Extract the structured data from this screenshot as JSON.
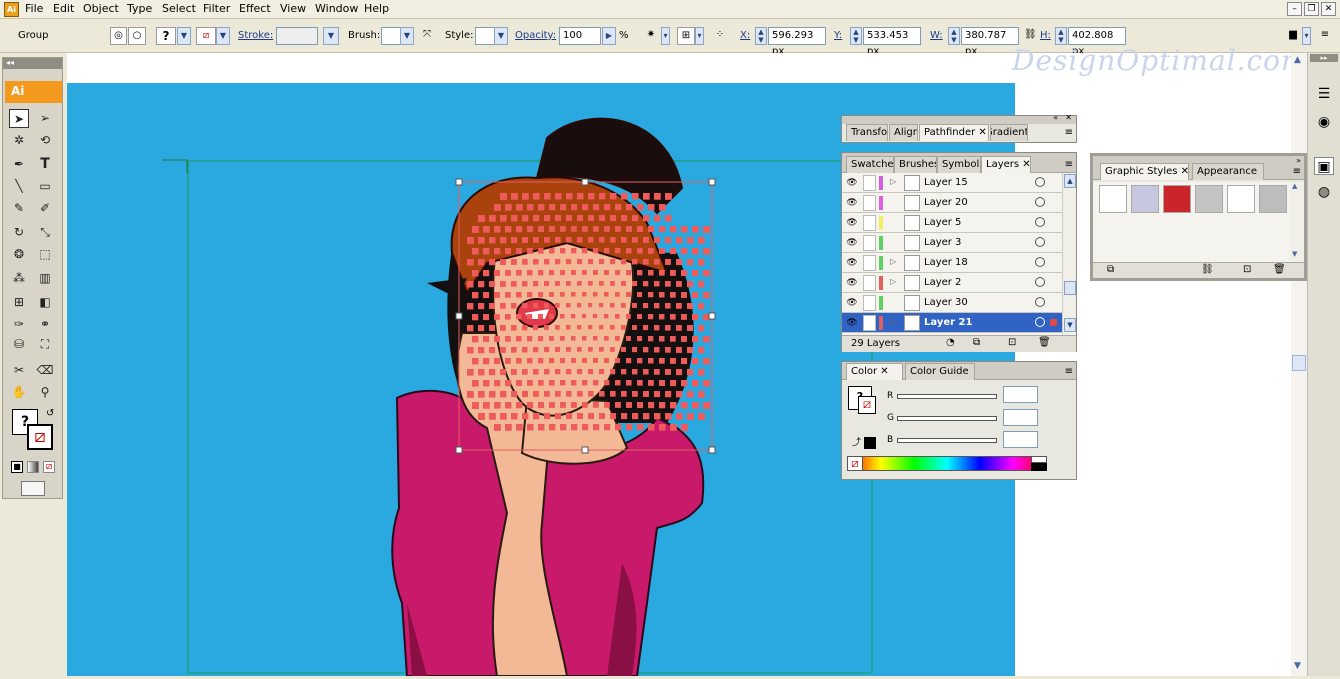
{
  "menubar": {
    "app_icon": "Ai",
    "items": [
      "File",
      "Edit",
      "Object",
      "Type",
      "Select",
      "Filter",
      "Effect",
      "View",
      "Window",
      "Help"
    ]
  },
  "controlbar": {
    "selection_type": "Group",
    "stroke_label": "Stroke:",
    "brush_label": "Brush:",
    "style_label": "Style:",
    "opacity_label": "Opacity:",
    "opacity_value": "100",
    "opacity_unit": "%",
    "x_label": "X:",
    "x_value": "596.293 px",
    "y_label": "Y:",
    "y_value": "533.453 px",
    "w_label": "W:",
    "w_value": "380.787 px",
    "h_label": "H:",
    "h_value": "402.808 px",
    "fill_glyph": "?"
  },
  "toolbox": {
    "logo": "Ai",
    "fill_glyph": "?"
  },
  "watermark": "DesignOptimal.com",
  "panel_top": {
    "tabs": [
      "Transform",
      "Align",
      "Pathfinder",
      "Gradient"
    ]
  },
  "layers_panel": {
    "tabs": [
      "Swatches",
      "Brushes",
      "Symbols",
      "Layers"
    ],
    "rows": [
      {
        "name": "Layer 15",
        "color": "#d060e0",
        "expand": true,
        "selected": false
      },
      {
        "name": "Layer 20",
        "color": "#e060e0",
        "expand": false,
        "selected": false
      },
      {
        "name": "Layer 5",
        "color": "#f0f060",
        "expand": false,
        "selected": false
      },
      {
        "name": "Layer 3",
        "color": "#60d060",
        "expand": false,
        "selected": false
      },
      {
        "name": "Layer 18",
        "color": "#60d060",
        "expand": true,
        "selected": false
      },
      {
        "name": "Layer 2",
        "color": "#e06060",
        "expand": true,
        "selected": false
      },
      {
        "name": "Layer 30",
        "color": "#60d060",
        "expand": false,
        "selected": false
      },
      {
        "name": "Layer 21",
        "color": "#e06060",
        "expand": true,
        "selected": true
      }
    ],
    "count": "29 Layers"
  },
  "color_panel": {
    "tabs": [
      "Color",
      "Color Guide"
    ],
    "channels": [
      "R",
      "G",
      "B"
    ],
    "fill_glyph": "?"
  },
  "graphic_styles_panel": {
    "tabs": [
      "Graphic Styles",
      "Appearance"
    ],
    "swatch_colors": [
      "#ffffff",
      "#c7c8e0",
      "#c9252b",
      "#c4c4c4",
      "#ffffff",
      "#bdbdbd"
    ]
  },
  "colors": {
    "artboard_bg": "#2aa9e0",
    "selection_blue": "#3163c5",
    "accent_orange": "#f39a1e"
  }
}
